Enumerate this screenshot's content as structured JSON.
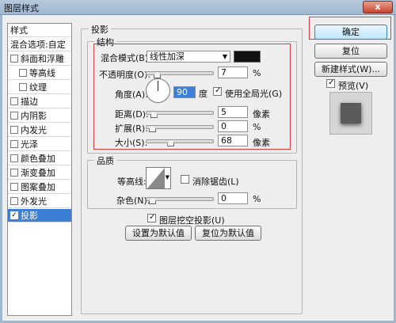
{
  "window": {
    "title": "图层样式",
    "close_label": "x"
  },
  "style_list": {
    "header": "样式",
    "blend_options": "混合选项:自定",
    "items": [
      {
        "label": "斜面和浮雕",
        "checked": false,
        "indent": false
      },
      {
        "label": "等高线",
        "checked": false,
        "indent": true
      },
      {
        "label": "纹理",
        "checked": false,
        "indent": true
      },
      {
        "label": "描边",
        "checked": false,
        "indent": false
      },
      {
        "label": "内阴影",
        "checked": false,
        "indent": false
      },
      {
        "label": "内发光",
        "checked": false,
        "indent": false
      },
      {
        "label": "光泽",
        "checked": false,
        "indent": false
      },
      {
        "label": "颜色叠加",
        "checked": false,
        "indent": false
      },
      {
        "label": "渐变叠加",
        "checked": false,
        "indent": false
      },
      {
        "label": "图案叠加",
        "checked": false,
        "indent": false
      },
      {
        "label": "外发光",
        "checked": false,
        "indent": false
      },
      {
        "label": "投影",
        "checked": true,
        "indent": false
      }
    ]
  },
  "drop_shadow": {
    "section_title": "投影",
    "structure_title": "结构",
    "blend_mode_label": "混合模式(B):",
    "blend_mode_value": "线性加深",
    "blend_color": "#111111",
    "opacity_label": "不透明度(O):",
    "opacity_value": "7",
    "opacity_unit": "%",
    "opacity_level": 0.07,
    "angle_label": "角度(A):",
    "angle_value": "90",
    "angle_unit": "度",
    "global_light_label": "使用全局光(G)",
    "global_light_checked": true,
    "distance_label": "距离(D):",
    "distance_value": "5",
    "distance_unit": "像素",
    "distance_level": 0.02,
    "spread_label": "扩展(R):",
    "spread_value": "0",
    "spread_unit": "%",
    "spread_level": 0.0,
    "size_label": "大小(S):",
    "size_value": "68",
    "size_unit": "像素",
    "size_level": 0.27,
    "quality_title": "品质",
    "contour_label": "等高线:",
    "anti_alias_label": "消除锯齿(L)",
    "anti_alias_checked": false,
    "noise_label": "杂色(N):",
    "noise_value": "0",
    "noise_unit": "%",
    "noise_level": 0.0,
    "knockout_label": "图层挖空投影(U)",
    "knockout_checked": true,
    "make_default_label": "设置为默认值",
    "reset_default_label": "复位为默认值"
  },
  "buttons": {
    "ok": "确定",
    "cancel": "复位",
    "new_style": "新建样式(W)...",
    "preview_label": "预览(V)",
    "preview_checked": true
  }
}
